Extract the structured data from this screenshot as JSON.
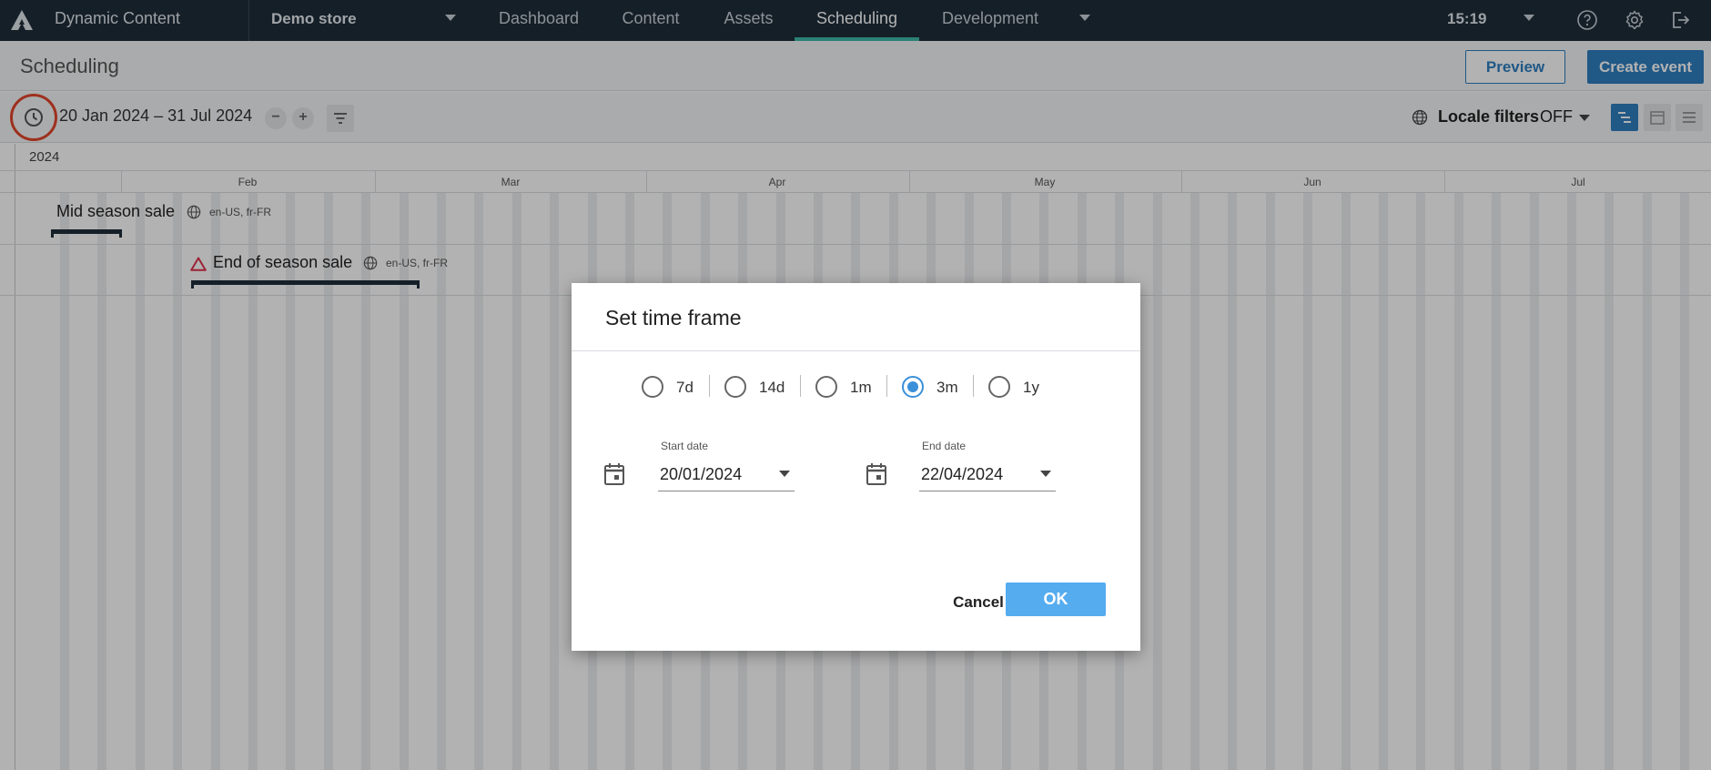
{
  "nav": {
    "app_title": "Dynamic Content",
    "store": "Demo store",
    "tabs": [
      {
        "label": "Dashboard"
      },
      {
        "label": "Content"
      },
      {
        "label": "Assets"
      },
      {
        "label": "Scheduling",
        "active": true
      },
      {
        "label": "Development"
      }
    ],
    "time": "15:19",
    "icons": [
      "help-icon",
      "settings-icon",
      "logout-icon"
    ]
  },
  "subheader": {
    "title": "Scheduling",
    "preview_label": "Preview",
    "create_label": "Create event"
  },
  "toolbar": {
    "date_range": "20 Jan 2024 – 31 Jul 2024",
    "zoom_out": "−",
    "zoom_in": "+",
    "locale_label": "Locale filters",
    "locale_value": "OFF"
  },
  "timeline": {
    "year": "2024",
    "months": [
      "Feb",
      "Mar",
      "Apr",
      "May",
      "Jun",
      "Jul"
    ],
    "events": [
      {
        "name": "Mid season sale",
        "locales": "en-US, fr-FR",
        "warning": false
      },
      {
        "name": "End of season sale",
        "locales": "en-US, fr-FR",
        "warning": true
      }
    ]
  },
  "modal": {
    "title": "Set time frame",
    "options": [
      {
        "label": "7d",
        "checked": false
      },
      {
        "label": "14d",
        "checked": false
      },
      {
        "label": "1m",
        "checked": false
      },
      {
        "label": "3m",
        "checked": true
      },
      {
        "label": "1y",
        "checked": false
      }
    ],
    "start_label": "Start date",
    "start_value": "20/01/2024",
    "end_label": "End date",
    "end_value": "22/04/2024",
    "cancel_label": "Cancel",
    "ok_label": "OK"
  },
  "colors": {
    "nav_bg": "#1f2d3a",
    "accent": "#3fb8a8",
    "primary": "#2f7fc1",
    "ok_button": "#55acef",
    "highlight_ring": "#e2452b",
    "warning": "#e0334d"
  }
}
